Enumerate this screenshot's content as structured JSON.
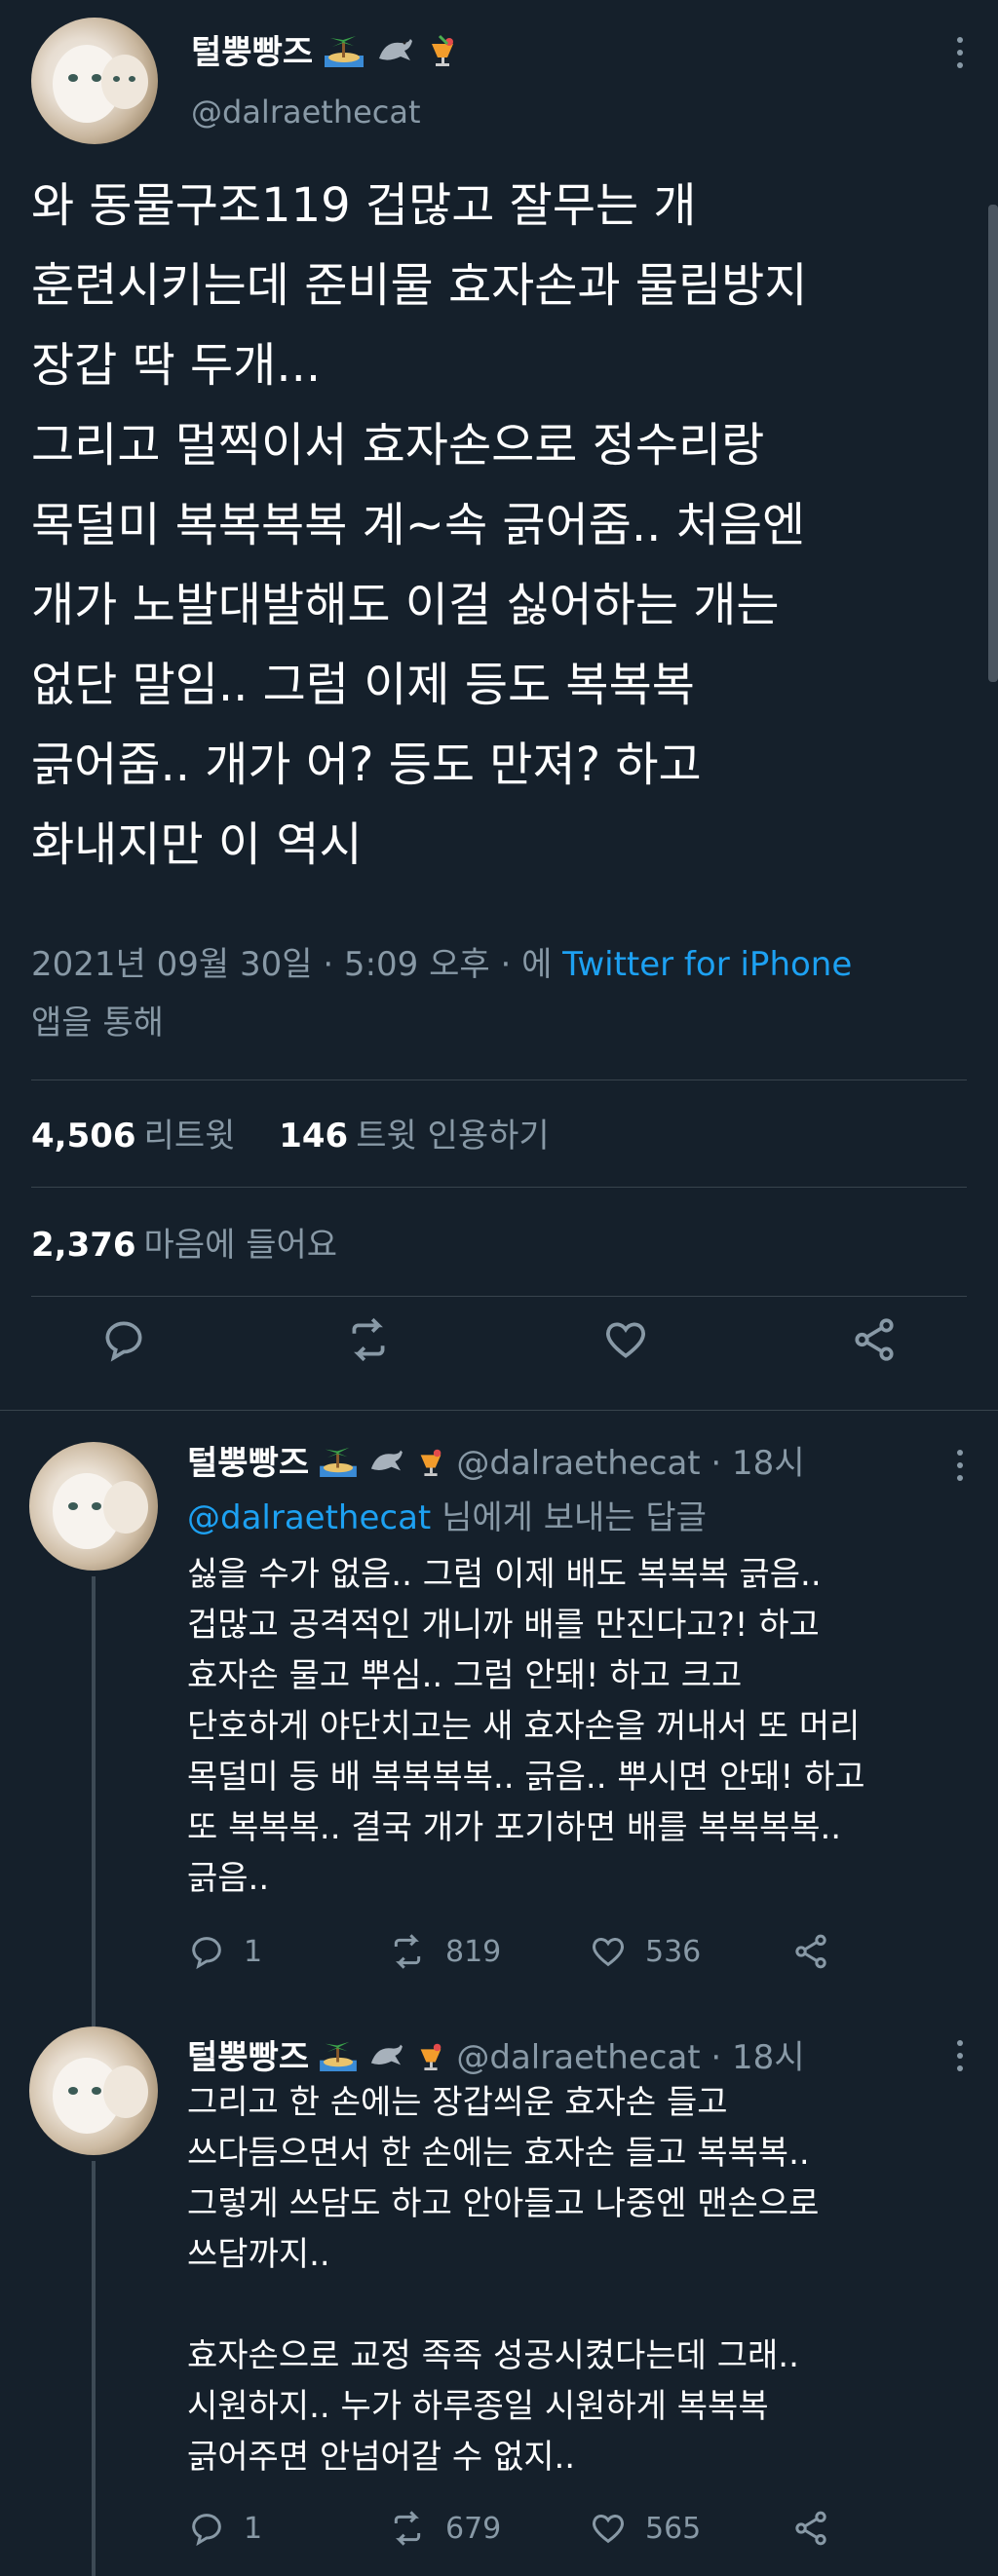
{
  "main": {
    "display_name": "털뿡빵즈",
    "handle": "@dalraethecat",
    "text": "와 동물구조119 겁많고 잘무는 개\n훈련시키는데 준비물 효자손과 물림방지\n장갑 딱 두개...\n그리고 멀찍이서 효자손으로 정수리랑\n목덜미 복복복복 계~속 긁어줌.. 처음엔\n개가 노발대발해도 이걸 싫어하는 개는\n없단 말임.. 그럼 이제 등도 복복복\n긁어줌.. 개가 어? 등도 만져? 하고\n화내지만 이 역시",
    "timestamp": "2021년 09월 30일 · 5:09 오후 · 에 ",
    "source": "Twitter for iPhone",
    "via": "앱을 통해",
    "retweets": "4,506",
    "retweets_label": "리트윗",
    "quotes": "146",
    "quotes_label": "트윗 인용하기",
    "likes": "2,376",
    "likes_label": "마음에 들어요"
  },
  "replies": [
    {
      "display_name": "털뿡빵즈",
      "handle": "@dalraethecat · 18시",
      "reply_to_handle": "@dalraethecat",
      "reply_to_suffix": " 님에게 보내는 답글",
      "text": "싫을 수가 없음.. 그럼 이제 배도 복복복 긁음..\n겁많고 공격적인 개니까 배를 만진다고?! 하고\n효자손 물고 뿌심.. 그럼 안돼! 하고 크고\n단호하게 야단치고는 새 효자손을 꺼내서 또 머리\n목덜미 등 배 복복복복.. 긁음.. 뿌시면 안돼! 하고\n또 복복복.. 결국 개가 포기하면 배를 복복복복..\n긁음..",
      "reply_count": "1",
      "retweet_count": "819",
      "like_count": "536"
    },
    {
      "display_name": "털뿡빵즈",
      "handle": "@dalraethecat · 18시",
      "text": "그리고 한 손에는 장갑씌운 효자손 들고\n쓰다듬으면서 한 손에는 효자손 들고 복복복..\n그렇게 쓰담도 하고 안아들고 나중엔 맨손으로\n쓰담까지..\n\n효자손으로 교정 족족 성공시켰다는데 그래..\n시원하지.. 누가 하루종일 시원하게 복복복\n긁어주면 안넘어갈 수 없지..",
      "reply_count": "1",
      "retweet_count": "679",
      "like_count": "565"
    }
  ],
  "colors": {
    "background": "#15202b",
    "secondary_text": "#8899a6",
    "link": "#1da1f2",
    "divider": "#38444d"
  }
}
